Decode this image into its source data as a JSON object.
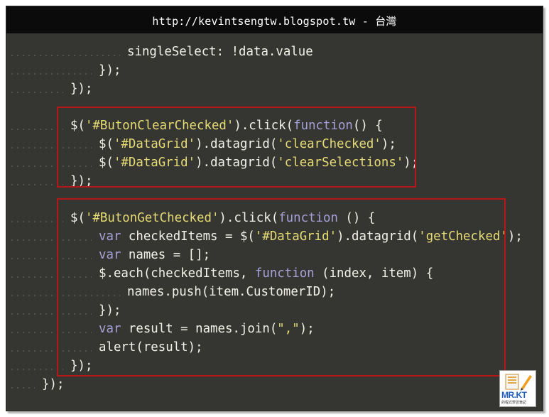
{
  "header": {
    "title": "http://kevintsengtw.blogspot.tw - 台灣"
  },
  "code_lines": [
    {
      "indent": 4,
      "tokens": [
        {
          "t": "singleSelect: !data.value",
          "c": "p"
        }
      ]
    },
    {
      "indent": 3,
      "tokens": [
        {
          "t": "});",
          "c": "p"
        }
      ]
    },
    {
      "indent": 2,
      "tokens": [
        {
          "t": "});",
          "c": "p"
        }
      ]
    },
    {
      "indent": 0,
      "tokens": []
    },
    {
      "indent": 2,
      "tokens": [
        {
          "t": "$(",
          "c": "p"
        },
        {
          "t": "'#ButonClearChecked'",
          "c": "s"
        },
        {
          "t": ").click(",
          "c": "p"
        },
        {
          "t": "function",
          "c": "k"
        },
        {
          "t": "() {",
          "c": "p"
        }
      ]
    },
    {
      "indent": 3,
      "tokens": [
        {
          "t": "$(",
          "c": "p"
        },
        {
          "t": "'#DataGrid'",
          "c": "s"
        },
        {
          "t": ").datagrid(",
          "c": "p"
        },
        {
          "t": "'clearChecked'",
          "c": "s"
        },
        {
          "t": ");",
          "c": "p"
        }
      ]
    },
    {
      "indent": 3,
      "tokens": [
        {
          "t": "$(",
          "c": "p"
        },
        {
          "t": "'#DataGrid'",
          "c": "s"
        },
        {
          "t": ").datagrid(",
          "c": "p"
        },
        {
          "t": "'clearSelections'",
          "c": "s"
        },
        {
          "t": ");",
          "c": "p"
        }
      ]
    },
    {
      "indent": 2,
      "tokens": [
        {
          "t": "});",
          "c": "p"
        }
      ]
    },
    {
      "indent": 0,
      "tokens": []
    },
    {
      "indent": 2,
      "tokens": [
        {
          "t": "$(",
          "c": "p"
        },
        {
          "t": "'#ButonGetChecked'",
          "c": "s"
        },
        {
          "t": ").click(",
          "c": "p"
        },
        {
          "t": "function",
          "c": "k"
        },
        {
          "t": " () {",
          "c": "p"
        }
      ]
    },
    {
      "indent": 3,
      "tokens": [
        {
          "t": "var",
          "c": "k"
        },
        {
          "t": " checkedItems = $(",
          "c": "p"
        },
        {
          "t": "'#DataGrid'",
          "c": "s"
        },
        {
          "t": ").datagrid(",
          "c": "p"
        },
        {
          "t": "'getChecked'",
          "c": "s"
        },
        {
          "t": ");",
          "c": "p"
        }
      ]
    },
    {
      "indent": 3,
      "tokens": [
        {
          "t": "var",
          "c": "k"
        },
        {
          "t": " names = [];",
          "c": "p"
        }
      ]
    },
    {
      "indent": 3,
      "tokens": [
        {
          "t": "$.each(checkedItems, ",
          "c": "p"
        },
        {
          "t": "function",
          "c": "k"
        },
        {
          "t": " (index, item) {",
          "c": "p"
        }
      ]
    },
    {
      "indent": 4,
      "tokens": [
        {
          "t": "names.push(item.CustomerID);",
          "c": "p"
        }
      ]
    },
    {
      "indent": 3,
      "tokens": [
        {
          "t": "});",
          "c": "p"
        }
      ]
    },
    {
      "indent": 3,
      "tokens": [
        {
          "t": "var",
          "c": "k"
        },
        {
          "t": " result = names.join(",
          "c": "p"
        },
        {
          "t": "\",\"",
          "c": "s"
        },
        {
          "t": ");",
          "c": "p"
        }
      ]
    },
    {
      "indent": 3,
      "tokens": [
        {
          "t": "alert(result);",
          "c": "p"
        }
      ]
    },
    {
      "indent": 2,
      "tokens": [
        {
          "t": "});",
          "c": "p"
        }
      ]
    },
    {
      "indent": 1,
      "tokens": [
        {
          "t": "});",
          "c": "p"
        }
      ]
    }
  ],
  "colors": {
    "background": "#353632",
    "plain": "#f2f2e8",
    "string": "#e6db74",
    "keyword": "#a6a0d6",
    "highlight_border": "#b51616"
  },
  "highlights": [
    {
      "label": "clear-checked-block"
    },
    {
      "label": "get-checked-block"
    }
  ],
  "watermark": {
    "brand": "MR.KT",
    "tagline": "的程式學習筆記"
  }
}
